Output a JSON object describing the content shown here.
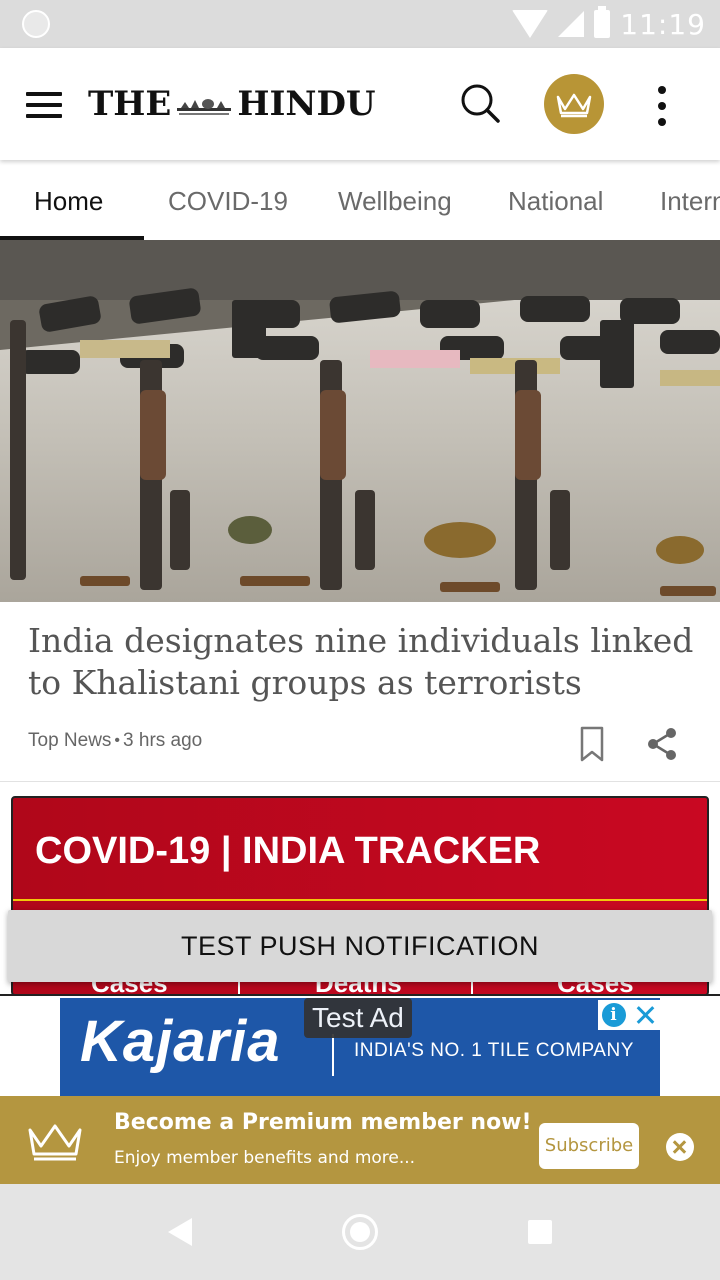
{
  "status_bar": {
    "time": "11:19"
  },
  "header": {
    "logo_left": "THE",
    "logo_right": "HINDU",
    "icons": [
      "menu-icon",
      "search-icon",
      "crown-icon",
      "more-vert-icon"
    ]
  },
  "tabs": [
    {
      "label": "Home",
      "active": true
    },
    {
      "label": "COVID-19",
      "active": false
    },
    {
      "label": "Wellbeing",
      "active": false
    },
    {
      "label": "National",
      "active": false
    },
    {
      "label": "Intern",
      "active": false
    }
  ],
  "article": {
    "headline": "India designates nine individuals linked to Khalistani groups as terrorists",
    "section": "Top News",
    "separator": "•",
    "time_ago": "3 hrs ago"
  },
  "tracker": {
    "title": "COVID-19 | INDIA TRACKER",
    "columns": [
      "Cases",
      "Deaths",
      "Cases"
    ]
  },
  "push_notification": {
    "text": "TEST PUSH NOTIFICATION"
  },
  "ad": {
    "label": "Test Ad",
    "brand": "Kajaria",
    "tagline": "INDIA'S NO. 1 TILE COMPANY",
    "choices_icon": "i"
  },
  "premium": {
    "title": "Become a Premium member now!",
    "subtitle": "Enjoy member benefits and more...",
    "button": "Subscribe"
  },
  "colors": {
    "gold": "#b49640",
    "tracker_red": "#c90822",
    "ad_blue": "#1e57a8"
  }
}
